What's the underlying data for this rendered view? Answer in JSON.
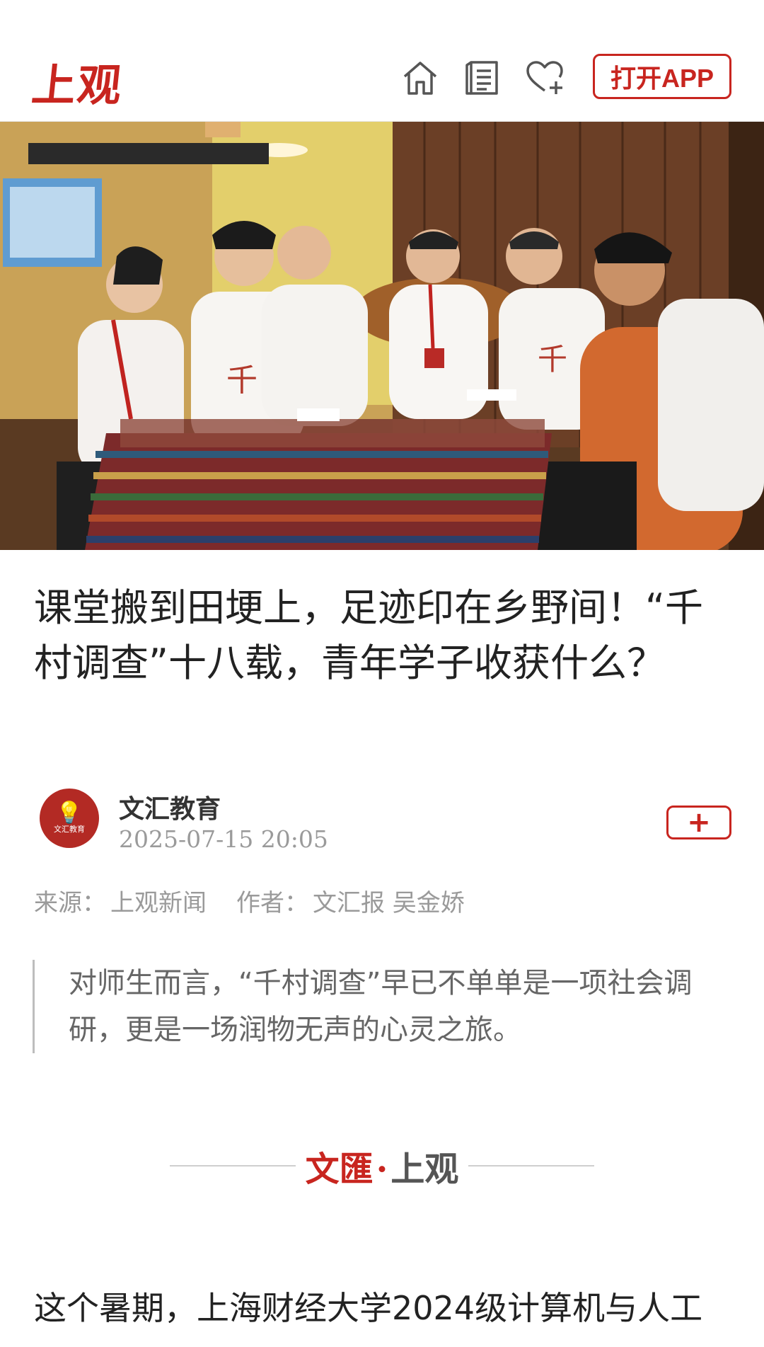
{
  "header": {
    "logo_text": "上观",
    "open_app_label": "打开APP",
    "icons": [
      "home-icon",
      "news-icon",
      "favorite-add-icon"
    ]
  },
  "hero_image": {
    "description_icon": "photo"
  },
  "article": {
    "title": "课堂搬到田埂上，足迹印在乡野间！“千村调查”十八载，青年学子收获什么？",
    "author": {
      "name": "文汇教育",
      "avatar_text": "文汇教育",
      "time": "2025-07-15 20:05",
      "follow_label": "+"
    },
    "meta": {
      "source_label": "来源：",
      "source_value": "上观新闻",
      "author_label": "作者：",
      "author_value": "文汇报 吴金娇"
    },
    "summary": "对师生而言，“千村调查”早已不单单是一项社会调研，更是一场润物无声的心灵之旅。",
    "brand": {
      "left": "文匯",
      "dot": "·",
      "right": "上观"
    },
    "body_first_line": "这个暑期，上海财经大学2024级计算机与人工"
  },
  "colors": {
    "accent": "#c8251f",
    "muted_text": "#9a9a9a"
  }
}
